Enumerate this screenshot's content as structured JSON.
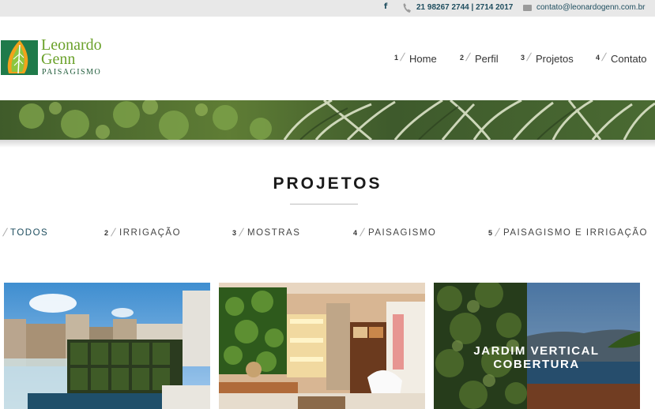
{
  "topbar": {
    "facebook_icon": "facebook-icon",
    "phone_icon": "phone-icon",
    "phone": "21 98267 2744 | 2714 2017",
    "mail_icon": "mail-icon",
    "email": "contato@leonardogenn.com.br"
  },
  "logo": {
    "line1": "Leonardo",
    "line2": "Genn",
    "line3": "PAISAGISMO"
  },
  "nav": [
    {
      "num": "1",
      "label": "Home"
    },
    {
      "num": "2",
      "label": "Perfil"
    },
    {
      "num": "3",
      "label": "Projetos"
    },
    {
      "num": "4",
      "label": "Contato"
    }
  ],
  "section": {
    "title": "PROJETOS"
  },
  "filters": [
    {
      "num": "",
      "label": "TODOS"
    },
    {
      "num": "2",
      "label": "IRRIGAÇÃO"
    },
    {
      "num": "3",
      "label": "MOSTRAS"
    },
    {
      "num": "4",
      "label": "PAISAGISMO"
    },
    {
      "num": "5",
      "label": "PAISAGISMO E IRRIGAÇÃO"
    }
  ],
  "cards": [
    {
      "caption": ""
    },
    {
      "caption": ""
    },
    {
      "caption": "JARDIM VERTICAL COBERTURA"
    }
  ],
  "colors": {
    "accent": "#1f4e5f",
    "logo_green": "#6aa12a"
  }
}
